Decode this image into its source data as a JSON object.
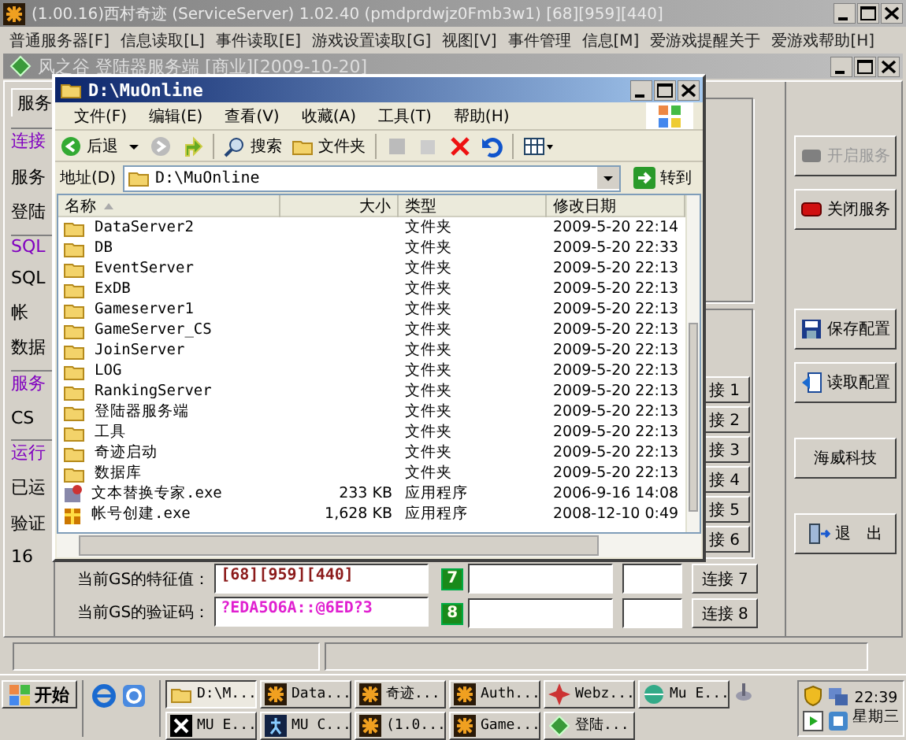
{
  "main_window": {
    "title": "(1.00.16)西村奇迹 (ServiceServer) 1.02.40 (pmdprdwjz0Fmb3w1) [68][959][440]",
    "menu": [
      "普通服务器[F]",
      "信息读取[L]",
      "事件读取[E]",
      "游戏设置读取[G]",
      "视图[V]",
      "事件管理",
      "信息[M]",
      "爱游戏提醒关于",
      "爱游戏帮助[H]"
    ],
    "child_title": "风之谷 登陆器服务端 [商业][2009-10-20]",
    "side_labels": [
      {
        "text": "服务",
        "kind": "tab"
      },
      {
        "text": "连接",
        "kind": "group"
      },
      {
        "text": "服务",
        "kind": "label"
      },
      {
        "text": "登陆",
        "kind": "label"
      },
      {
        "text": "SQL",
        "kind": "group"
      },
      {
        "text": "SQL",
        "kind": "label"
      },
      {
        "text": "帐",
        "kind": "label"
      },
      {
        "text": "数据",
        "kind": "label"
      },
      {
        "text": "服务",
        "kind": "group"
      },
      {
        "text": "CS",
        "kind": "label"
      },
      {
        "text": "运行",
        "kind": "group"
      },
      {
        "text": "已运",
        "kind": "label"
      },
      {
        "text": "验证",
        "kind": "label"
      },
      {
        "text": "16",
        "kind": "label"
      }
    ],
    "connect_buttons": [
      "接 1",
      "接 2",
      "接 3",
      "接 4",
      "接 5",
      "接 6"
    ],
    "gs_fields": [
      {
        "label": "当前GS的特征值：",
        "value": "[68][959][440]",
        "color": "#8b1a1a"
      },
      {
        "label": "当前GS的验证码：",
        "value": "?EDA5O6A::@6ED?3",
        "color": "#e020d0"
      }
    ],
    "connect_rows": [
      {
        "number": "7",
        "button": "连接 7"
      },
      {
        "number": "8",
        "button": "连接 8"
      }
    ],
    "buttons": [
      {
        "label": "开启服务",
        "kind": "start",
        "disabled": true
      },
      {
        "label": "关闭服务",
        "kind": "stop",
        "disabled": false
      },
      {
        "label": "保存配置",
        "kind": "save",
        "disabled": false
      },
      {
        "label": "读取配置",
        "kind": "load",
        "disabled": false
      },
      {
        "label": "海威科技",
        "kind": "plain",
        "disabled": false
      },
      {
        "label": "退　出",
        "kind": "exit",
        "disabled": false
      }
    ]
  },
  "explorer": {
    "title": "D:\\MuOnline",
    "menu": [
      "文件(F)",
      "编辑(E)",
      "查看(V)",
      "收藏(A)",
      "工具(T)",
      "帮助(H)"
    ],
    "toolbar": {
      "back": "后退",
      "search": "搜索",
      "folders": "文件夹"
    },
    "address": {
      "label": "地址(D)",
      "value": "D:\\MuOnline",
      "go": "转到"
    },
    "columns": [
      "名称",
      "大小",
      "类型",
      "修改日期"
    ],
    "files": [
      {
        "name": "DataServer2",
        "type": "文件夹",
        "modified": "2009-5-20 22:14",
        "kind": "folder"
      },
      {
        "name": "DB",
        "type": "文件夹",
        "modified": "2009-5-20 22:33",
        "kind": "folder"
      },
      {
        "name": "EventServer",
        "type": "文件夹",
        "modified": "2009-5-20 22:13",
        "kind": "folder"
      },
      {
        "name": "ExDB",
        "type": "文件夹",
        "modified": "2009-5-20 22:13",
        "kind": "folder"
      },
      {
        "name": "Gameserver1",
        "type": "文件夹",
        "modified": "2009-5-20 22:13",
        "kind": "folder"
      },
      {
        "name": "GameServer_CS",
        "type": "文件夹",
        "modified": "2009-5-20 22:13",
        "kind": "folder"
      },
      {
        "name": "JoinServer",
        "type": "文件夹",
        "modified": "2009-5-20 22:13",
        "kind": "folder"
      },
      {
        "name": "LOG",
        "type": "文件夹",
        "modified": "2009-5-20 22:13",
        "kind": "folder"
      },
      {
        "name": "RankingServer",
        "type": "文件夹",
        "modified": "2009-5-20 22:13",
        "kind": "folder"
      },
      {
        "name": "登陆器服务端",
        "type": "文件夹",
        "modified": "2009-5-20 22:13",
        "kind": "folder"
      },
      {
        "name": "工具",
        "type": "文件夹",
        "modified": "2009-5-20 22:13",
        "kind": "folder"
      },
      {
        "name": "奇迹启动",
        "type": "文件夹",
        "modified": "2009-5-20 22:13",
        "kind": "folder"
      },
      {
        "name": "数据库",
        "type": "文件夹",
        "modified": "2009-5-20 22:13",
        "kind": "folder"
      },
      {
        "name": "文本替换专家.exe",
        "size": "233 KB",
        "type": "应用程序",
        "modified": "2006-9-16 14:08",
        "kind": "app"
      },
      {
        "name": "帐号创建.exe",
        "size": "1,628 KB",
        "type": "应用程序",
        "modified": "2008-12-10 0:49",
        "kind": "gift"
      }
    ]
  },
  "taskbar": {
    "start": "开始",
    "tasks": [
      {
        "label": "D:\\M...",
        "kind": "folder",
        "selected": true
      },
      {
        "label": "Data...",
        "kind": "mu",
        "selected": false
      },
      {
        "label": "奇迹...",
        "kind": "mu",
        "selected": false
      },
      {
        "label": "Auth...",
        "kind": "mu",
        "selected": false
      },
      {
        "label": "Webz...",
        "kind": "star",
        "selected": false
      },
      {
        "label": "Mu E...",
        "kind": "globe",
        "selected": false
      },
      {
        "label": "MU E...",
        "kind": "cross",
        "selected": false
      },
      {
        "label": "MU C...",
        "kind": "runner",
        "selected": false
      },
      {
        "label": "(1.0...",
        "kind": "mu",
        "selected": false
      },
      {
        "label": "Game...",
        "kind": "mu",
        "selected": false
      },
      {
        "label": "登陆...",
        "kind": "diamond",
        "selected": false
      }
    ],
    "time": "22:39",
    "day": "星期三"
  }
}
